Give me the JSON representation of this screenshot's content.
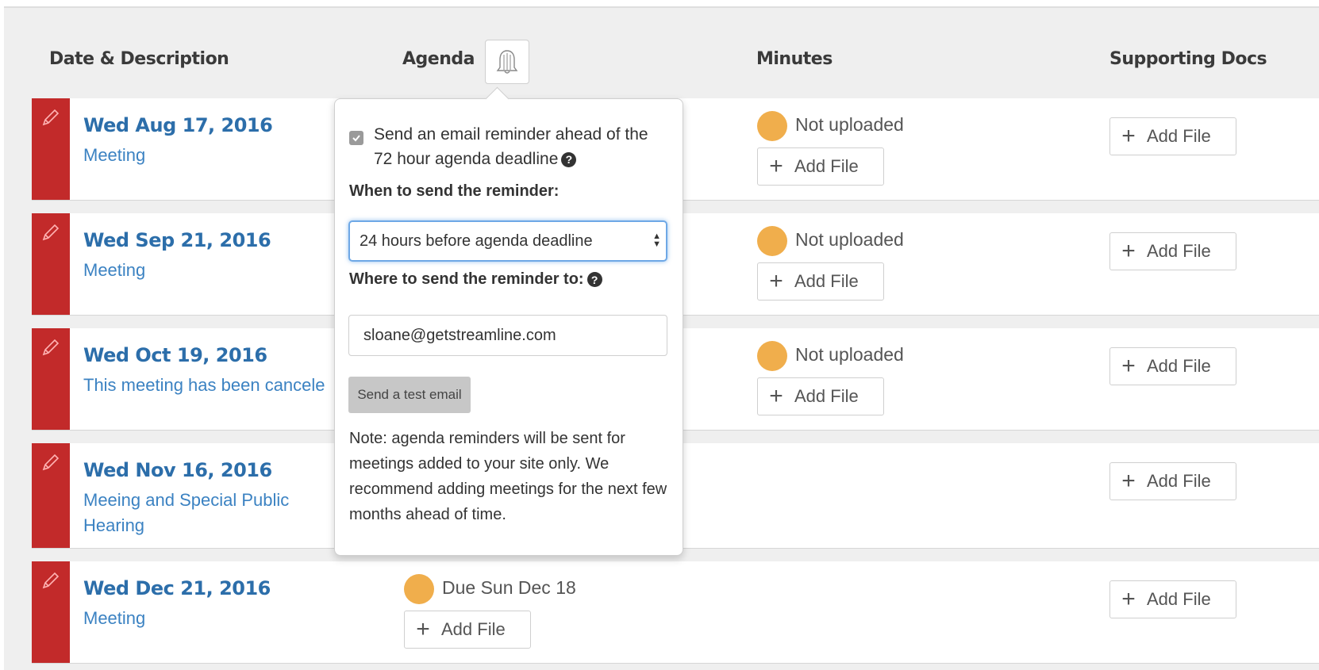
{
  "headers": {
    "date_description": "Date & Description",
    "agenda": "Agenda",
    "minutes": "Minutes",
    "supporting_docs": "Supporting Docs"
  },
  "add_file_label": "Add File",
  "meetings": [
    {
      "date": "Wed Aug 17, 2016",
      "description": "Meeting",
      "minutes_status": "Not uploaded"
    },
    {
      "date": "Wed Sep 21, 2016",
      "description": "Meeting",
      "minutes_status": "Not uploaded"
    },
    {
      "date": "Wed Oct 19, 2016",
      "description": "This meeting has been cancele",
      "minutes_status": "Not uploaded"
    },
    {
      "date": "Wed Nov 16, 2016",
      "description": "Meeing and Special Public Hearing"
    },
    {
      "date": "Wed Dec 21, 2016",
      "description": "Meeting",
      "agenda_status": "Due Sun Dec 18"
    }
  ],
  "reminder_popover": {
    "checkbox_checked": true,
    "checkbox_label": "Send an email reminder ahead of the 72 hour agenda deadline",
    "when_label": "When to send the reminder:",
    "when_selected": "24 hours before agenda deadline",
    "where_label": "Where to send the reminder to:",
    "email_value": "sloane@getstreamline.com",
    "test_button": "Send a test email",
    "note": "Note: agenda reminders will be sent for meetings added to your site only. We recommend adding meetings for the next few months ahead of time."
  },
  "colors": {
    "edit_bar": "#c22a2a",
    "link_blue": "#2c6eaa",
    "status_dot": "#f0ae4c",
    "focus_ring": "#6ea8e6"
  },
  "icons": {
    "edit": "pencil-icon",
    "reminder": "bell-icon",
    "help": "question-circle-icon",
    "add": "plus-icon"
  }
}
